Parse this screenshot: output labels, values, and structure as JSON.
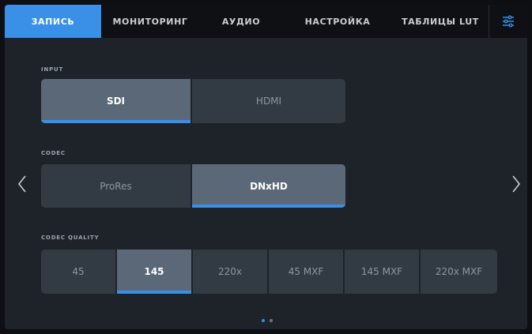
{
  "tabs": [
    {
      "label": "ЗАПИСЬ",
      "active": true
    },
    {
      "label": "МОНИТОРИНГ",
      "active": false
    },
    {
      "label": "АУДИО",
      "active": false
    },
    {
      "label": "НАСТРОЙКА",
      "active": false
    },
    {
      "label": "ТАБЛИЦЫ LUT",
      "active": false
    }
  ],
  "menu_icon": "sliders-icon",
  "input": {
    "label": "INPUT",
    "options": [
      "SDI",
      "HDMI"
    ],
    "selected": "SDI"
  },
  "codec": {
    "label": "CODEC",
    "options": [
      "ProRes",
      "DNxHD"
    ],
    "selected": "DNxHD"
  },
  "codec_quality": {
    "label": "CODEC QUALITY",
    "options": [
      "45",
      "145",
      "220x",
      "45 MXF",
      "145 MXF",
      "220x MXF"
    ],
    "selected": "145"
  },
  "nav": {
    "prev_icon": "chevron-left-icon",
    "next_icon": "chevron-right-icon"
  },
  "pagination": {
    "pages": 2,
    "current": 1
  },
  "colors": {
    "accent": "#3a8fe6",
    "panel": "#1e2329",
    "segment": "#323a44",
    "segment_selected": "#5b6877"
  }
}
